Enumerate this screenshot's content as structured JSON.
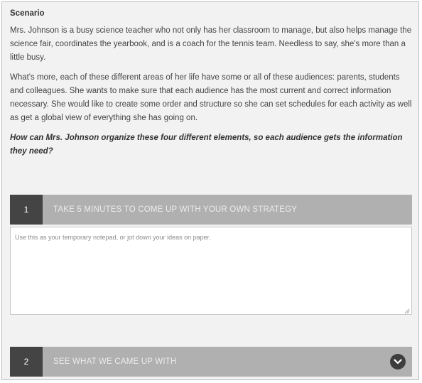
{
  "scenario": {
    "heading": "Scenario",
    "paragraph_1": "Mrs. Johnson is a busy science teacher who not only has her classroom to manage, but also helps manage the science fair, coordinates the yearbook, and is a coach for the tennis team. Needless to say, she's more than a little busy.",
    "paragraph_2": "What's more, each of these different areas of her life have some or all of these audiences: parents, students and colleagues. She wants to make sure that each audience has the most current and correct information necessary. She would like to create some order and structure so she can set schedules for each activity as well as get a global view of everything she has going on.",
    "question": "How can Mrs. Johnson organize these four different elements, so each audience gets the information they need?"
  },
  "steps": [
    {
      "number": "1",
      "title": "TAKE 5 MINUTES TO COME UP WITH YOUR OWN STRATEGY"
    },
    {
      "number": "2",
      "title": "SEE WHAT WE CAME UP WITH",
      "icon": "chevron-down-icon"
    }
  ],
  "notepad": {
    "placeholder": "Use this as your temporary notepad, or jot down your ideas on paper.",
    "value": ""
  },
  "colors": {
    "background": "#f2f2f2",
    "step_bar": "#b0b0b0",
    "step_number": "#444444"
  }
}
